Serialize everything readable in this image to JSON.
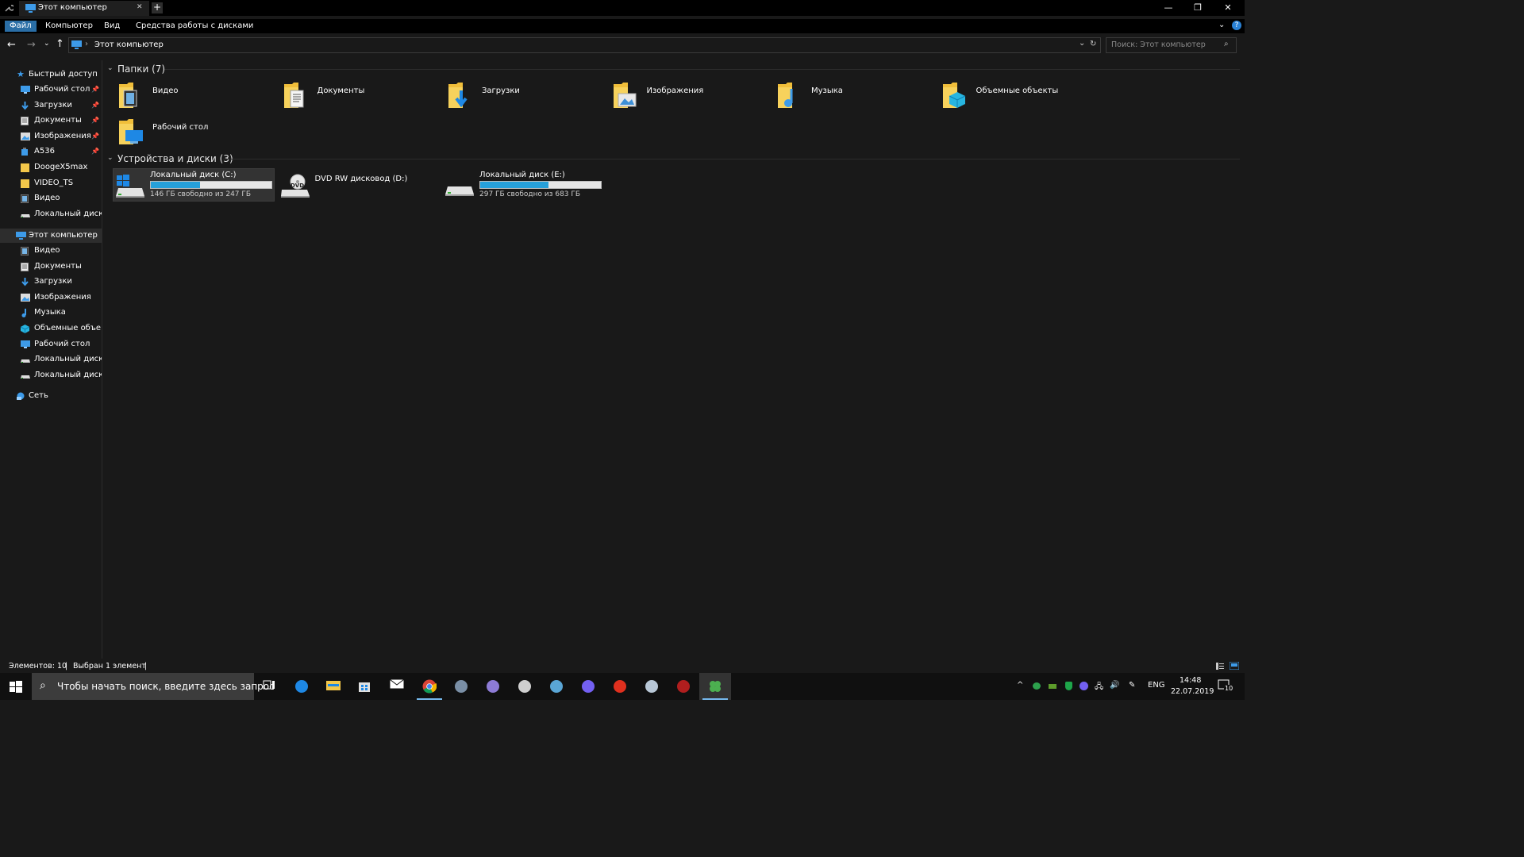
{
  "window": {
    "tab_title": "Этот компьютер",
    "new_tab_symbol": "+",
    "minimize": "—",
    "restore": "❐",
    "close": "✕"
  },
  "ribbon": {
    "file": "Файл",
    "computer": "Компьютер",
    "view": "Вид",
    "disk_tools": "Средства работы с дисками"
  },
  "address": {
    "path": "Этот компьютер",
    "search_placeholder": "Поиск: Этот компьютер"
  },
  "sidebar": {
    "quick_access": {
      "label": "Быстрый доступ",
      "items": [
        {
          "label": "Рабочий стол",
          "icon": "desktop-icon",
          "pinned": true
        },
        {
          "label": "Загрузки",
          "icon": "downloads-icon",
          "pinned": true
        },
        {
          "label": "Документы",
          "icon": "documents-icon",
          "pinned": true
        },
        {
          "label": "Изображения",
          "icon": "pictures-icon",
          "pinned": true
        },
        {
          "label": "A536",
          "icon": "device-icon",
          "pinned": true
        },
        {
          "label": "DoogeX5max",
          "icon": "folder-icon",
          "pinned": false
        },
        {
          "label": "VIDEO_TS",
          "icon": "folder-icon",
          "pinned": false
        },
        {
          "label": "Видео",
          "icon": "videos-icon",
          "pinned": false
        },
        {
          "label": "Локальный диск (E",
          "icon": "drive-icon",
          "pinned": false
        }
      ]
    },
    "this_pc": {
      "label": "Этот компьютер",
      "items": [
        {
          "label": "Видео",
          "icon": "videos-icon"
        },
        {
          "label": "Документы",
          "icon": "documents-icon"
        },
        {
          "label": "Загрузки",
          "icon": "downloads-icon"
        },
        {
          "label": "Изображения",
          "icon": "pictures-icon"
        },
        {
          "label": "Музыка",
          "icon": "music-icon"
        },
        {
          "label": "Объемные объекты",
          "icon": "3d-objects-icon"
        },
        {
          "label": "Рабочий стол",
          "icon": "desktop-icon"
        },
        {
          "label": "Локальный диск (C",
          "icon": "drive-icon"
        },
        {
          "label": "Локальный диск (E",
          "icon": "drive-icon"
        }
      ]
    },
    "network": {
      "label": "Сеть"
    }
  },
  "content": {
    "folders_header": "Папки (7)",
    "folders": [
      {
        "label": "Видео",
        "icon": "videos-folder-icon"
      },
      {
        "label": "Документы",
        "icon": "documents-folder-icon"
      },
      {
        "label": "Загрузки",
        "icon": "downloads-folder-icon"
      },
      {
        "label": "Изображения",
        "icon": "pictures-folder-icon"
      },
      {
        "label": "Музыка",
        "icon": "music-folder-icon"
      },
      {
        "label": "Объемные объекты",
        "icon": "3d-objects-folder-icon"
      },
      {
        "label": "Рабочий стол",
        "icon": "desktop-folder-icon"
      }
    ],
    "devices_header": "Устройства и диски (3)",
    "drives": [
      {
        "name": "Локальный диск (C:)",
        "free": "146 ГБ свободно из 247 ГБ",
        "used_fraction": 0.41,
        "has_bar": true,
        "selected": true,
        "icon": "windows-drive-icon"
      },
      {
        "name": "DVD RW дисковод (D:)",
        "free": "",
        "has_bar": false,
        "selected": false,
        "icon": "dvd-drive-icon",
        "icon_text": "DVD"
      },
      {
        "name": "Локальный диск (E:)",
        "free": "297 ГБ свободно из 683 ГБ",
        "used_fraction": 0.565,
        "has_bar": true,
        "selected": false,
        "icon": "drive-icon"
      }
    ]
  },
  "status": {
    "items_count": "Элементов: 10",
    "selected": "Выбран 1 элемент"
  },
  "taskbar": {
    "search_placeholder": "Чтобы начать поиск, введите здесь запрос",
    "apps": [
      "task-view-icon",
      "edge-icon",
      "file-explorer-icon",
      "store-icon",
      "mail-icon",
      "chrome-icon",
      "game-icon",
      "browser-icon",
      "steam-icon",
      "app-icon",
      "viber-icon",
      "opera-icon",
      "world-of-warships-icon",
      "app-red-icon",
      "clover-icon"
    ],
    "lang": "ENG",
    "time": "14:48",
    "date": "22.07.2019",
    "notifications": "10"
  }
}
